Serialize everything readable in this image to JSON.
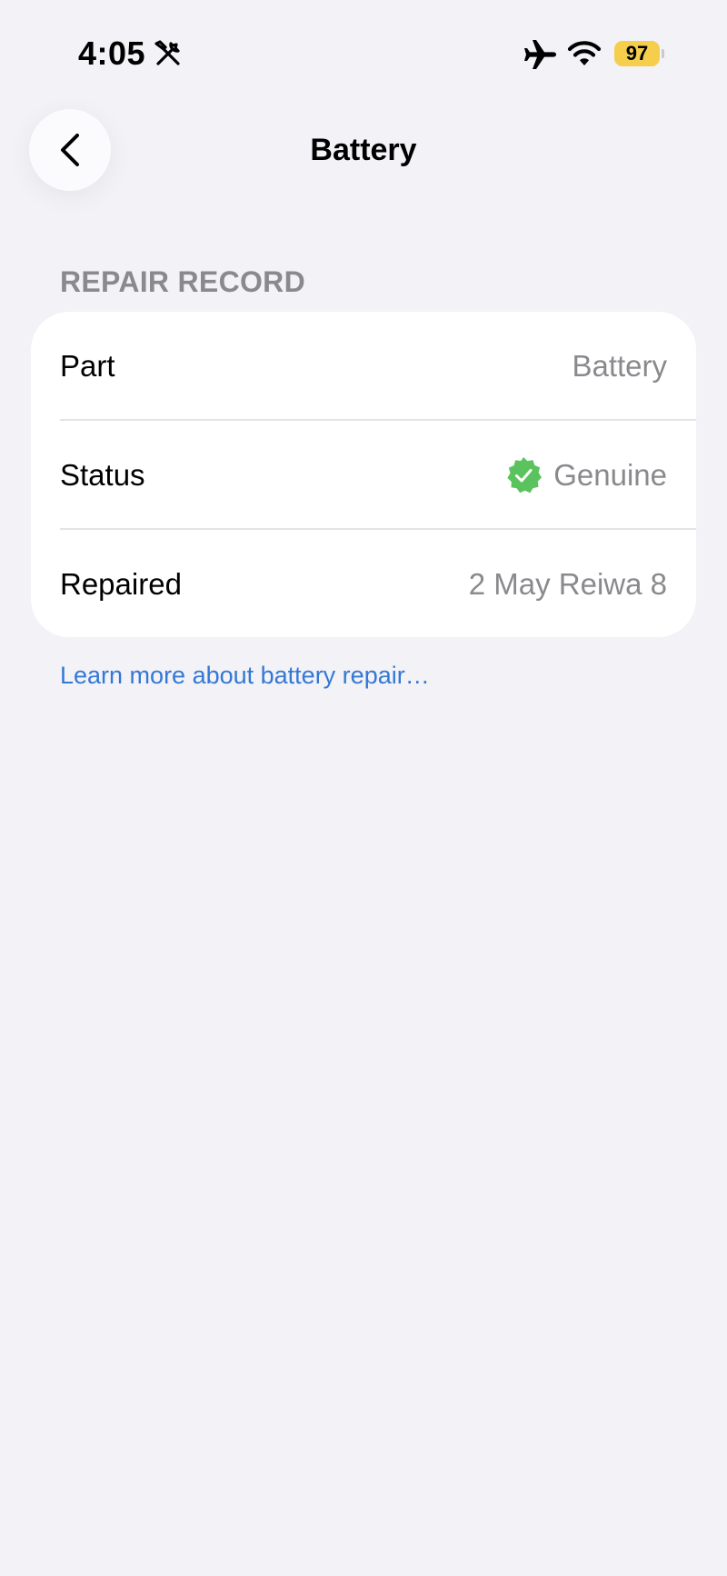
{
  "status_bar": {
    "time": "4:05",
    "battery_level": "97",
    "icons": [
      "tools-icon",
      "airplane-icon",
      "wifi-icon"
    ],
    "battery_color": "#f5cf4b"
  },
  "nav": {
    "back_icon": "chevron-left-icon",
    "title": "Battery"
  },
  "section": {
    "header": "REPAIR RECORD",
    "rows": [
      {
        "label": "Part",
        "value": "Battery"
      },
      {
        "label": "Status",
        "value": "Genuine",
        "icon": "verified-badge-icon"
      },
      {
        "label": "Repaired",
        "value": "2 May Reiwa 8"
      }
    ]
  },
  "footer": {
    "link_text": "Learn more about battery repair…"
  },
  "colors": {
    "background": "#f2f2f7",
    "card": "#ffffff",
    "secondary_text": "#8a8a8e",
    "link": "#3478d4",
    "verified_green": "#5ac35e"
  }
}
